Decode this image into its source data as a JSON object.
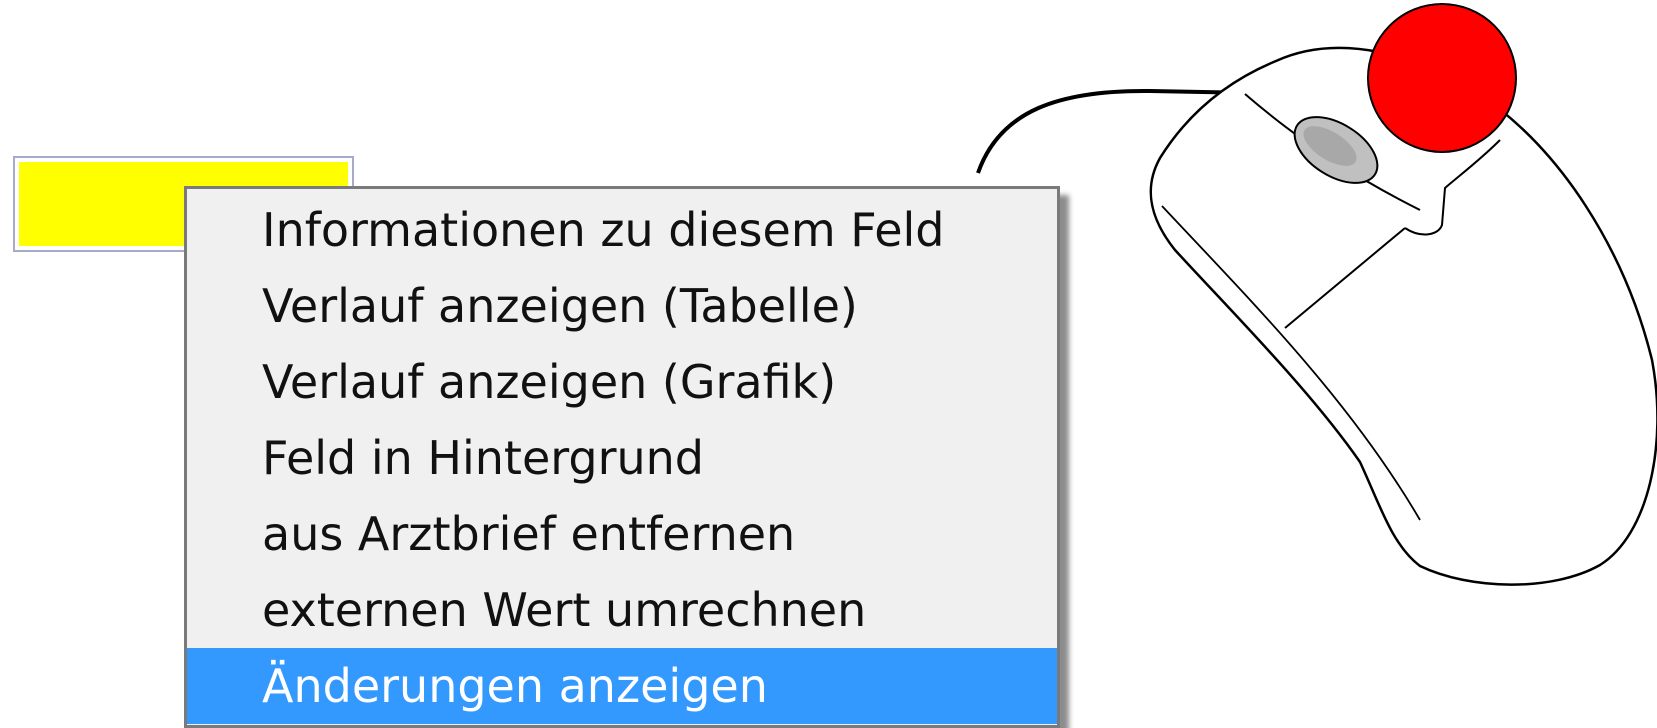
{
  "colors": {
    "field_fill": "#ffff00",
    "menu_background": "#f0f0f0",
    "selection_highlight": "#3399ff",
    "mouse_button_indicator": "#ff0000"
  },
  "field": {
    "state": "highlighted-yellow"
  },
  "context_menu": {
    "items": [
      {
        "label": "Informationen zu diesem Feld",
        "selected": false
      },
      {
        "label": "Verlauf anzeigen (Tabelle)",
        "selected": false
      },
      {
        "label": "Verlauf anzeigen (Grafik)",
        "selected": false
      },
      {
        "label": "Feld in Hintergrund",
        "selected": false
      },
      {
        "label": "aus Arztbrief entfernen",
        "selected": false
      },
      {
        "label": "externen Wert umrechnen",
        "selected": false
      },
      {
        "label": "Änderungen anzeigen",
        "selected": true
      }
    ]
  },
  "illustration": {
    "icon": "computer-mouse-icon",
    "indicator": "right-click-indicator"
  }
}
